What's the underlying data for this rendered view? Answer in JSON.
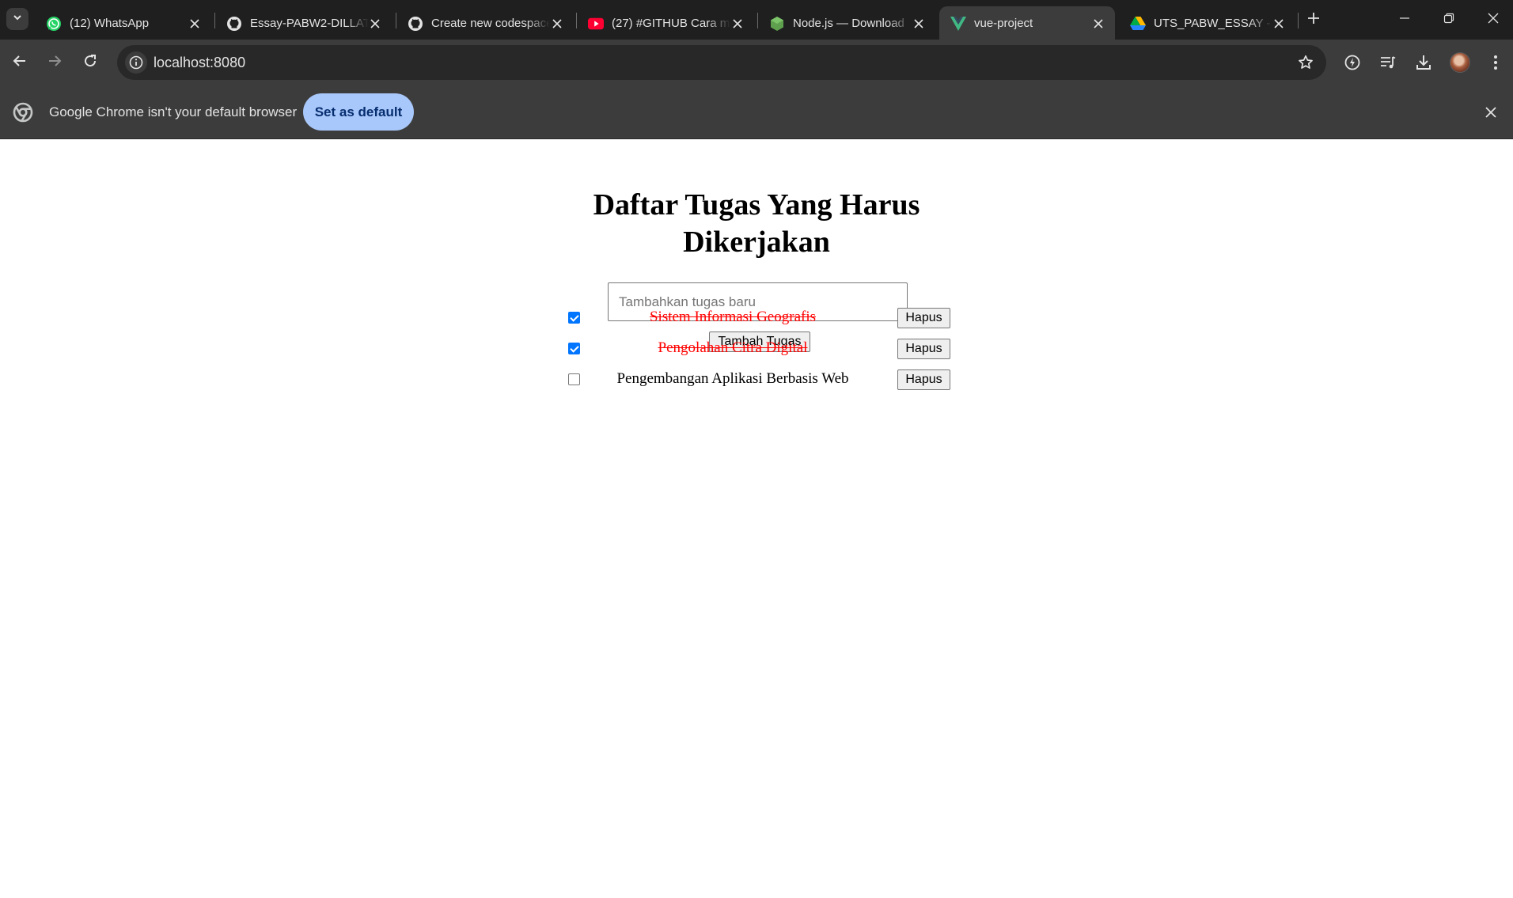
{
  "browser": {
    "tabs": [
      {
        "title": "(12) WhatsApp",
        "icon": "whatsapp-icon",
        "active": false
      },
      {
        "title": "Essay-PABW2-DILLATUL",
        "icon": "github-icon",
        "active": false
      },
      {
        "title": "Create new codespace",
        "icon": "github-icon",
        "active": false
      },
      {
        "title": "(27) #GITHUB Cara mudah",
        "icon": "youtube-icon",
        "active": false
      },
      {
        "title": "Node.js — Download",
        "icon": "nodejs-icon",
        "active": false
      },
      {
        "title": "vue-project",
        "icon": "vue-icon",
        "active": true
      },
      {
        "title": "UTS_PABW_ESSAY - Google Drive",
        "icon": "google-drive-icon",
        "active": false
      }
    ],
    "url": "localhost:8080",
    "infobar": {
      "message": "Google Chrome isn't your default browser",
      "button_label": "Set as default"
    },
    "colors": {
      "frame": "#1f1f1f",
      "toolbar": "#3c3c3c",
      "accent_button": "#a8c7fa"
    }
  },
  "app": {
    "title": "Daftar Tugas Yang Harus Dikerjakan",
    "input": {
      "placeholder": "Tambahkan tugas baru",
      "value": ""
    },
    "add_button_label": "Tambah Tugas",
    "tasks": [
      {
        "label": "Sistem Informasi Geografis",
        "done": true,
        "delete_label": "Hapus"
      },
      {
        "label": "Pengolahan Citra Digital",
        "done": true,
        "delete_label": "Hapus"
      },
      {
        "label": "Pengembangan Aplikasi Berbasis Web",
        "done": false,
        "delete_label": "Hapus"
      }
    ],
    "colors": {
      "done_text": "#ff0000",
      "checkbox": "#0075ff"
    }
  }
}
